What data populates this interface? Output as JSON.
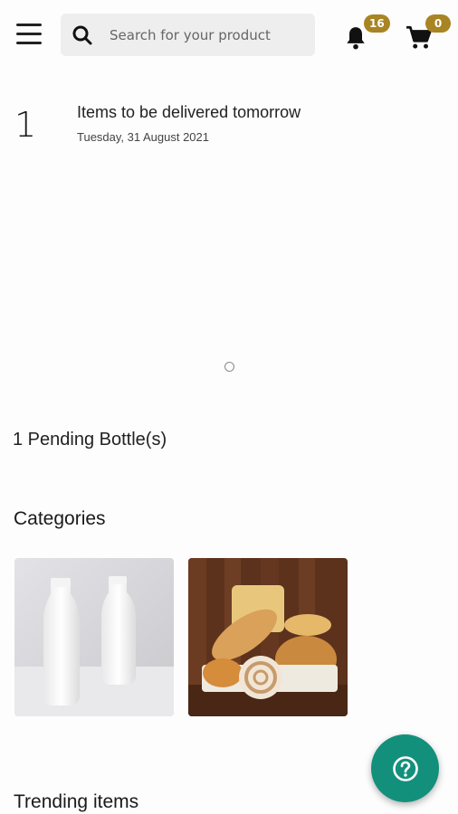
{
  "header": {
    "search_placeholder": "Search for your product",
    "notifications_count": "16",
    "cart_count": "0",
    "icons": [
      "menu-icon",
      "search-icon",
      "bell-icon",
      "cart-icon"
    ]
  },
  "delivery": {
    "count": "1",
    "title": "Items to be delivered tomorrow",
    "date": "Tuesday, 31 August 2021"
  },
  "pending": "1 Pending Bottle(s)",
  "categories": {
    "title": "Categories",
    "items": [
      "milk",
      "bakery"
    ]
  },
  "trending": {
    "title": "Trending items"
  },
  "colors": {
    "badge": "#a88423",
    "fab": "#13907b"
  },
  "fab_icon": "help-icon"
}
